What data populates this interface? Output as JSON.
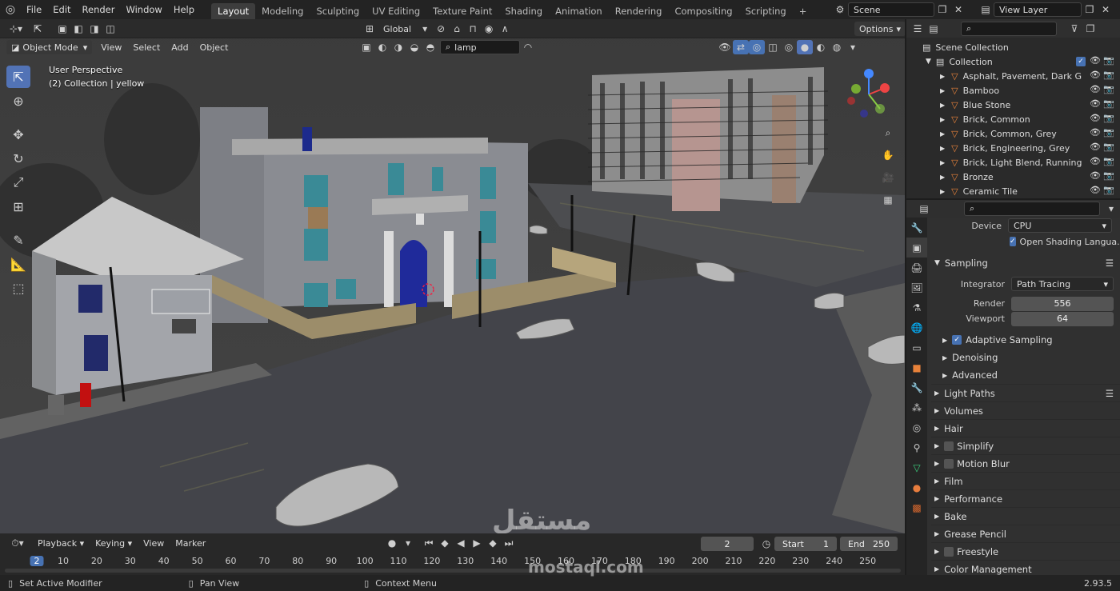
{
  "topbar": {
    "menus": [
      "File",
      "Edit",
      "Render",
      "Window",
      "Help"
    ],
    "workspaces": [
      "Layout",
      "Modeling",
      "Sculpting",
      "UV Editing",
      "Texture Paint",
      "Shading",
      "Animation",
      "Rendering",
      "Compositing",
      "Scripting"
    ],
    "active_workspace": "Layout",
    "scene_label": "Scene",
    "view_layer_label": "View Layer"
  },
  "viewport": {
    "transform_orientation": "Global",
    "options_label": "Options",
    "mode": "Object Mode",
    "menus": [
      "View",
      "Select",
      "Add",
      "Object"
    ],
    "search_value": "lamp",
    "overlay_line1": "User Perspective",
    "overlay_line2": "(2) Collection | yellow"
  },
  "outliner": {
    "scene_collection": "Scene Collection",
    "collection": "Collection",
    "items": [
      "Asphalt, Pavement, Dark G",
      "Bamboo",
      "Blue Stone",
      "Brick, Common",
      "Brick, Common, Grey",
      "Brick, Engineering, Grey",
      "Brick, Light Blend, Running",
      "Bronze",
      "Ceramic Tile"
    ]
  },
  "properties": {
    "device_label": "Device",
    "device_value": "CPU",
    "osl_label": "Open Shading Langua...",
    "sampling": {
      "title": "Sampling",
      "integrator_label": "Integrator",
      "integrator_value": "Path Tracing",
      "render_label": "Render",
      "render_value": "556",
      "viewport_label": "Viewport",
      "viewport_value": "64",
      "adaptive": "Adaptive Sampling",
      "denoising": "Denoising",
      "advanced": "Advanced"
    },
    "sections": [
      "Light Paths",
      "Volumes",
      "Hair",
      "Simplify",
      "Motion Blur",
      "Film",
      "Performance",
      "Bake",
      "Grease Pencil",
      "Freestyle",
      "Color Management"
    ]
  },
  "timeline": {
    "menus": [
      "Playback",
      "Keying",
      "View",
      "Marker"
    ],
    "current_frame": "2",
    "start_label": "Start",
    "start_value": "1",
    "end_label": "End",
    "end_value": "250",
    "ticks": [
      "2",
      "10",
      "20",
      "30",
      "40",
      "50",
      "60",
      "70",
      "80",
      "90",
      "100",
      "110",
      "120",
      "130",
      "140",
      "150",
      "160",
      "170",
      "180",
      "190",
      "200",
      "210",
      "220",
      "230",
      "240",
      "250"
    ]
  },
  "statusbar": {
    "left": "Set Active Modifier",
    "middle": "Pan View",
    "right": "Context Menu",
    "version": "2.93.5"
  },
  "watermark": {
    "arabic": "مستقل",
    "latin": "mostaql.com"
  }
}
